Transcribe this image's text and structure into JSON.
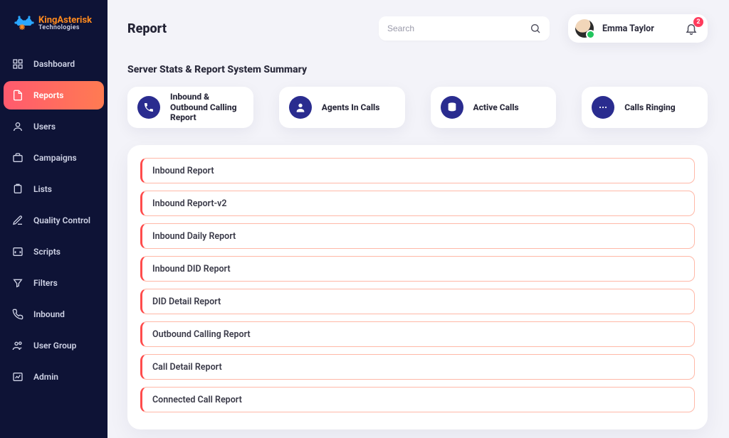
{
  "brand": {
    "top": "KingAsterisk",
    "bottom": "Technologies"
  },
  "sidebar": {
    "items": [
      {
        "label": "Dashboard"
      },
      {
        "label": "Reports"
      },
      {
        "label": "Users"
      },
      {
        "label": "Campaigns"
      },
      {
        "label": "Lists"
      },
      {
        "label": "Quality Control"
      },
      {
        "label": "Scripts"
      },
      {
        "label": "Filters"
      },
      {
        "label": "Inbound"
      },
      {
        "label": "User Group"
      },
      {
        "label": "Admin"
      }
    ]
  },
  "page": {
    "title": "Report",
    "section": "Server Stats & Report System Summary"
  },
  "search": {
    "placeholder": "Search"
  },
  "user": {
    "name": "Emma Taylor",
    "notifications": "2"
  },
  "cards": [
    {
      "label": "Inbound & Outbound Calling Report"
    },
    {
      "label": "Agents In Calls"
    },
    {
      "label": "Active Calls"
    },
    {
      "label": "Calls Ringing"
    }
  ],
  "reports": [
    "Inbound Report",
    "Inbound Report-v2",
    "Inbound Daily Report",
    "Inbound DID Report",
    "DID Detail Report",
    "Outbound Calling Report",
    "Call Detail Report",
    "Connected Call Report"
  ]
}
